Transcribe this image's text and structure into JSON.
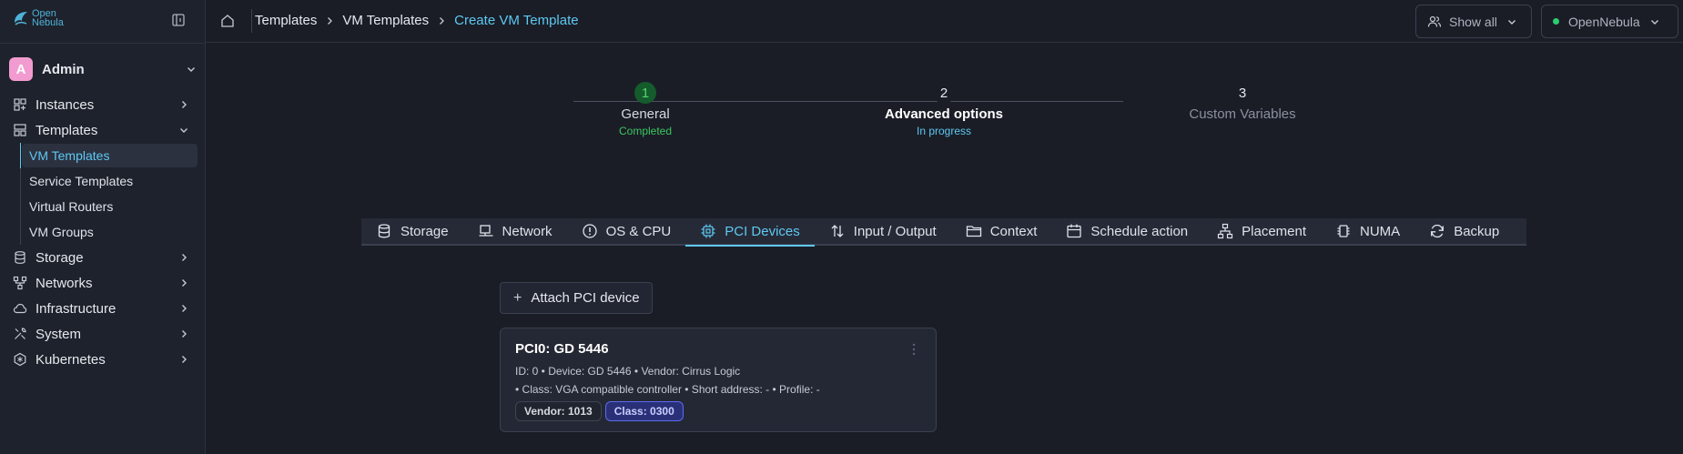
{
  "brand": {
    "line1": "Open",
    "line2": "Nebula"
  },
  "user": {
    "initial": "A",
    "name": "Admin"
  },
  "sidebar": {
    "items": [
      {
        "label": "Instances"
      },
      {
        "label": "Templates",
        "expanded": true,
        "children": [
          {
            "label": "VM Templates",
            "active": true
          },
          {
            "label": "Service Templates"
          },
          {
            "label": "Virtual Routers"
          },
          {
            "label": "VM Groups"
          }
        ]
      },
      {
        "label": "Storage"
      },
      {
        "label": "Networks"
      },
      {
        "label": "Infrastructure"
      },
      {
        "label": "System"
      },
      {
        "label": "Kubernetes"
      }
    ]
  },
  "breadcrumb": [
    "Templates",
    "VM Templates",
    "Create VM Template"
  ],
  "topbar": {
    "show_all": "Show all",
    "zone": "OpenNebula"
  },
  "stepper": [
    {
      "num": "1",
      "title": "General",
      "status": "Completed"
    },
    {
      "num": "2",
      "title": "Advanced options",
      "status": "In progress"
    },
    {
      "num": "3",
      "title": "Custom Variables",
      "status": ""
    }
  ],
  "tabs": [
    {
      "label": "Storage",
      "icon": "database-icon"
    },
    {
      "label": "Network",
      "icon": "monitor-icon"
    },
    {
      "label": "OS & CPU",
      "icon": "info-circle-icon"
    },
    {
      "label": "PCI Devices",
      "icon": "chip-icon",
      "active": true
    },
    {
      "label": "Input / Output",
      "icon": "arrows-updown-icon"
    },
    {
      "label": "Context",
      "icon": "folder-icon"
    },
    {
      "label": "Schedule action",
      "icon": "calendar-icon"
    },
    {
      "label": "Placement",
      "icon": "hierarchy-icon"
    },
    {
      "label": "NUMA",
      "icon": "cpu-icon"
    },
    {
      "label": "Backup",
      "icon": "refresh-icon"
    }
  ],
  "attach_label": "Attach PCI device",
  "pci_card": {
    "title": "PCI0: GD 5446",
    "meta1": "ID: 0 • Device: GD 5446 • Vendor: Cirrus Logic",
    "meta2": "• Class: VGA compatible controller • Short address: - • Profile: -",
    "chips": [
      "Vendor: 1013",
      "Class: 0300"
    ]
  },
  "colors": {
    "accent": "#5ec8f2",
    "success": "#3cc65f",
    "chip_blue": "#2a3078",
    "avatar": "#f29bd1"
  }
}
